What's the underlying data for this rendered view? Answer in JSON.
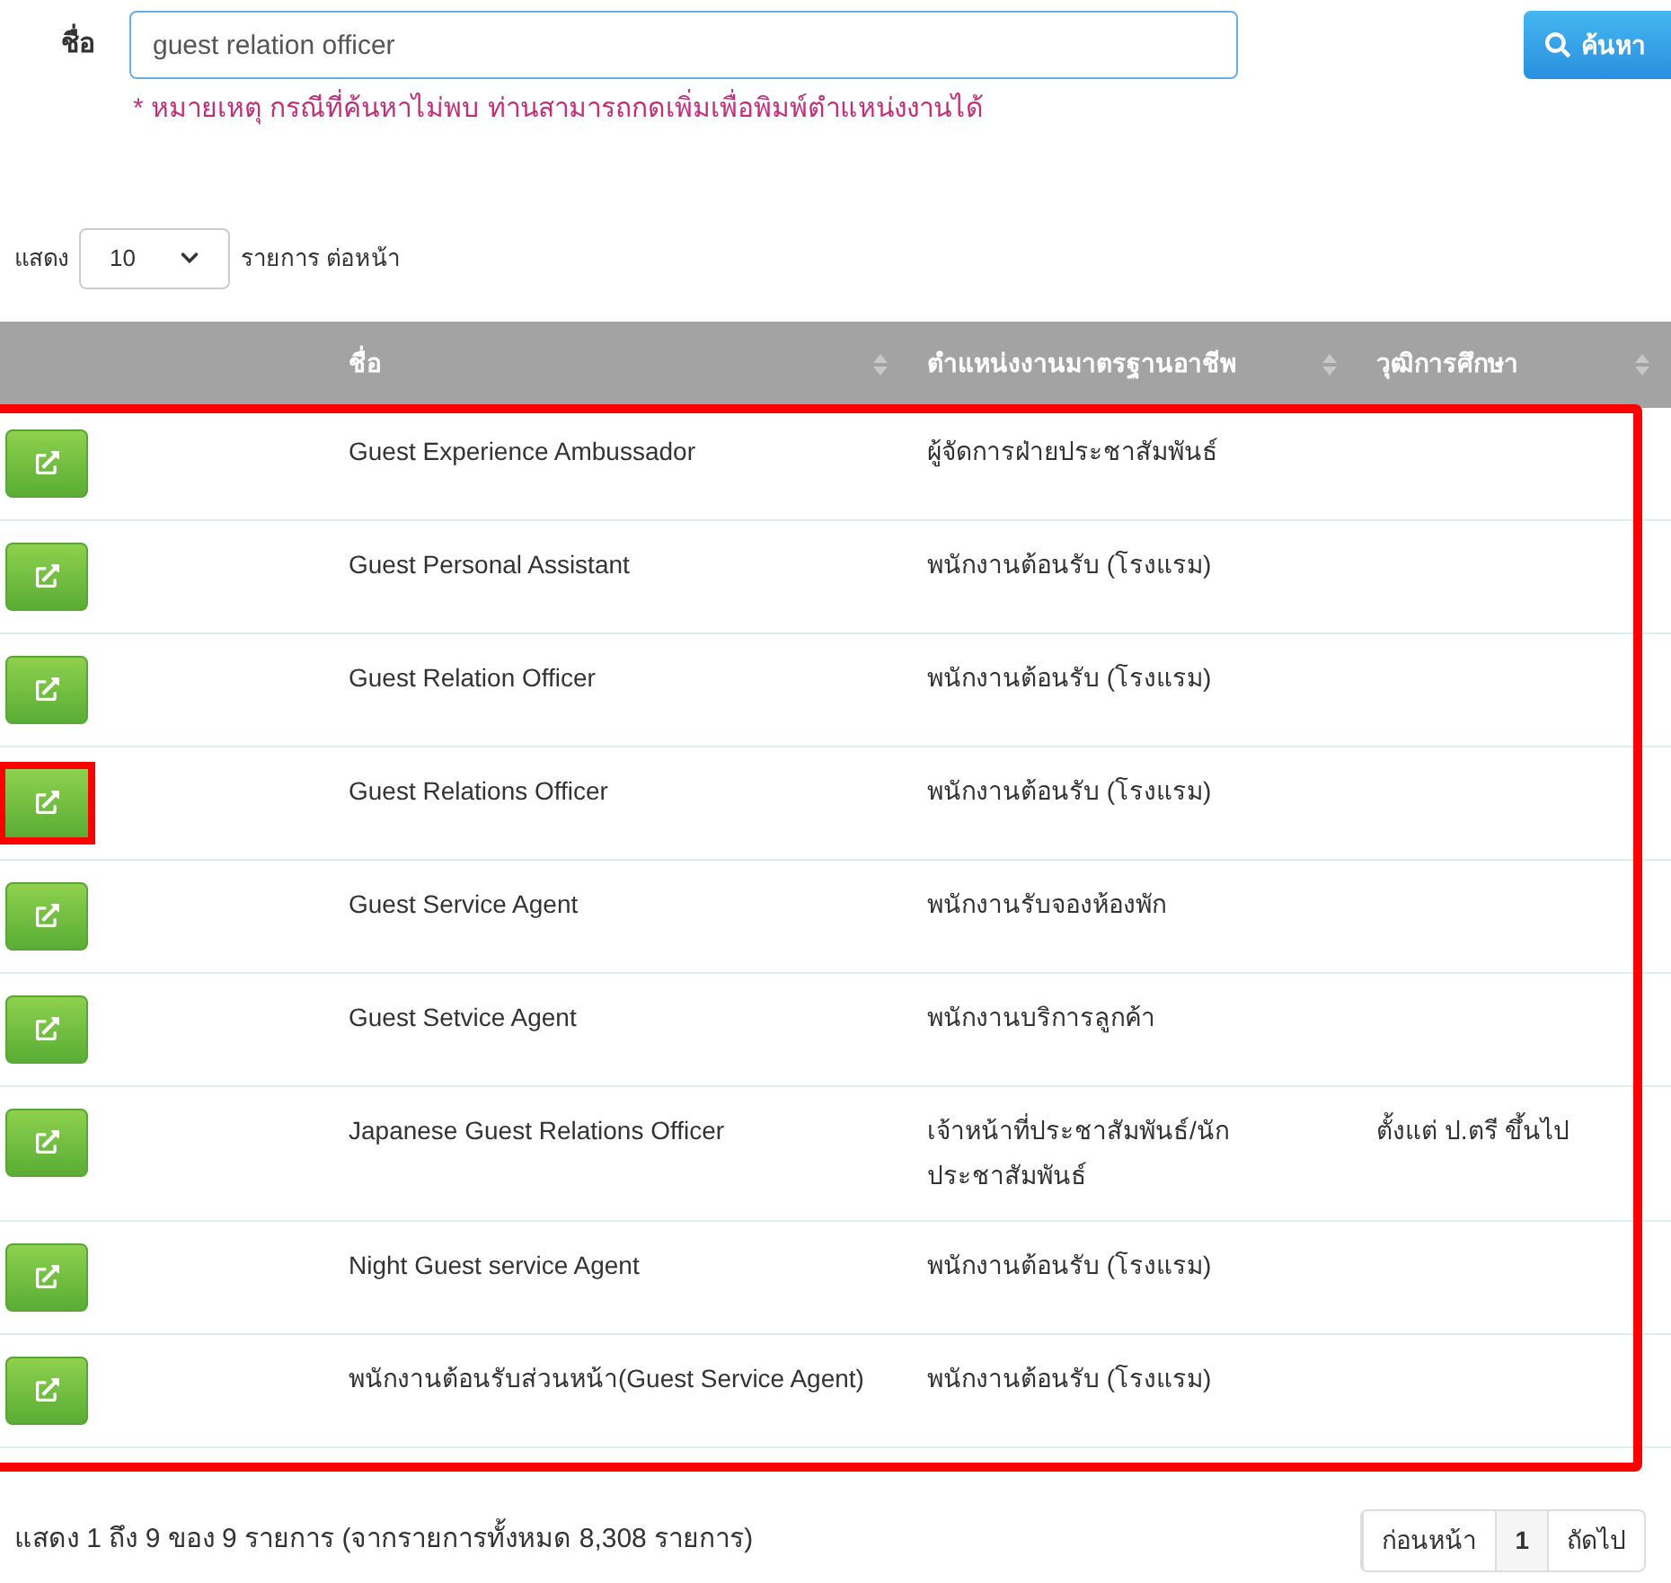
{
  "search": {
    "label": "ชื่อ",
    "value": "guest relation officer",
    "button": "ค้นหา",
    "note": "* หมายเหตุ กรณีที่ค้นหาไม่พบ ท่านสามารถกดเพิ่มเพื่อพิมพ์ตำแหน่งงานได้"
  },
  "page_size": {
    "prefix": "แสดง",
    "value": "10",
    "suffix": "รายการ ต่อหน้า"
  },
  "table": {
    "outlined": true,
    "columns": [
      "ชื่อ",
      "ตำแหน่งงานมาตรฐานอาชีพ",
      "วุฒิการศึกษา"
    ],
    "rows": [
      {
        "name": "Guest Experience Ambussador",
        "position": "ผู้จัดการฝ่ายประชาสัมพันธ์",
        "highlighted": false
      },
      {
        "name": "Guest Personal Assistant",
        "position": "พนักงานต้อนรับ (โรงแรม)",
        "highlighted": false
      },
      {
        "name": "Guest Relation Officer",
        "position": "พนักงานต้อนรับ (โรงแรม)",
        "highlighted": false
      },
      {
        "name": "Guest Relations Officer",
        "position": "พนักงานต้อนรับ (โรงแรม)",
        "highlighted": true
      },
      {
        "name": "Guest Service Agent",
        "position": "พนักงานรับจองห้องพัก",
        "highlighted": false
      },
      {
        "name": "Guest Setvice Agent",
        "position": "พนักงานบริการลูกค้า",
        "highlighted": false
      },
      {
        "name": "Japanese Guest Relations Officer",
        "position": "เจ้าหน้าที่ประชาสัมพันธ์/นักประชาสัมพันธ์",
        "education": "ตั้งแต่ ป.ตรี ขึ้นไป",
        "highlighted": false
      },
      {
        "name": "Night Guest service Agent",
        "position": "พนักงานต้อนรับ (โรงแรม)",
        "highlighted": false
      },
      {
        "name": "พนักงานต้อนรับส่วนหน้า(Guest Service Agent)",
        "position": "พนักงานต้อนรับ (โรงแรม)",
        "highlighted": false
      }
    ]
  },
  "footer": {
    "summary": "แสดง 1 ถึง 9 ของ 9 รายการ (จากรายการทั้งหมด 8,308 รายการ)",
    "pages": [
      {
        "label": "ก่อนหน้า",
        "selected": false
      },
      {
        "label": "1",
        "selected": true
      },
      {
        "label": "ถัดไป",
        "selected": false
      }
    ]
  }
}
